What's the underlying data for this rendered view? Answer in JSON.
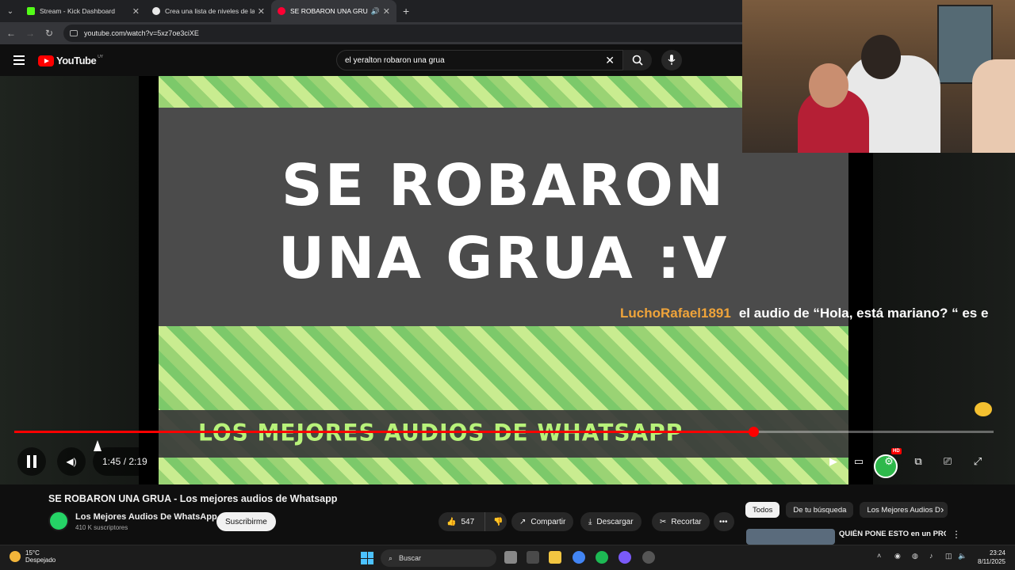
{
  "browser": {
    "tabs": [
      {
        "title": "Stream - Kick Dashboard",
        "color": "#53fc18"
      },
      {
        "title": "Crea una lista de niveles de las",
        "color": "#e8e8e8"
      },
      {
        "title": "SE ROBARON UNA GRUA -",
        "color": "#ff0033"
      }
    ],
    "url": "youtube.com/watch?v=5xz7oe3ciXE"
  },
  "youtube": {
    "logo": "YouTube",
    "country": "UY",
    "search_query": "el yeralton robaron una grua"
  },
  "video": {
    "overlay_title_line1": "SE ROBARON",
    "overlay_title_line2": "UNA GRUA :V",
    "banner_text": "LOS MEJORES AUDIOS DE WHATSAPP",
    "chat_user": "LuchoRafael1891",
    "chat_message": "el audio de “Hola, está mariano? “ es e",
    "time": "1:45 / 2:19",
    "progress": 0.755,
    "hd_badge": "HD"
  },
  "info": {
    "title": "SE ROBARON UNA GRUA - Los mejores audios de Whatsapp",
    "channel": "Los Mejores Audios De WhatsApp",
    "subscribers": "410 K suscriptores",
    "subscribe_label": "Suscribirme",
    "likes": "547",
    "share": "Compartir",
    "download": "Descargar",
    "clip": "Recortar",
    "chips": [
      "Todos",
      "De tu búsqueda",
      "Los Mejores Audios D"
    ],
    "reco_title": "QUIÉN PONE ESTO en un PROMPT?"
  },
  "taskbar": {
    "temp": "15°C",
    "weather": "Despejado",
    "search": "Buscar",
    "time": "23:24",
    "date": "8/11/2025"
  }
}
